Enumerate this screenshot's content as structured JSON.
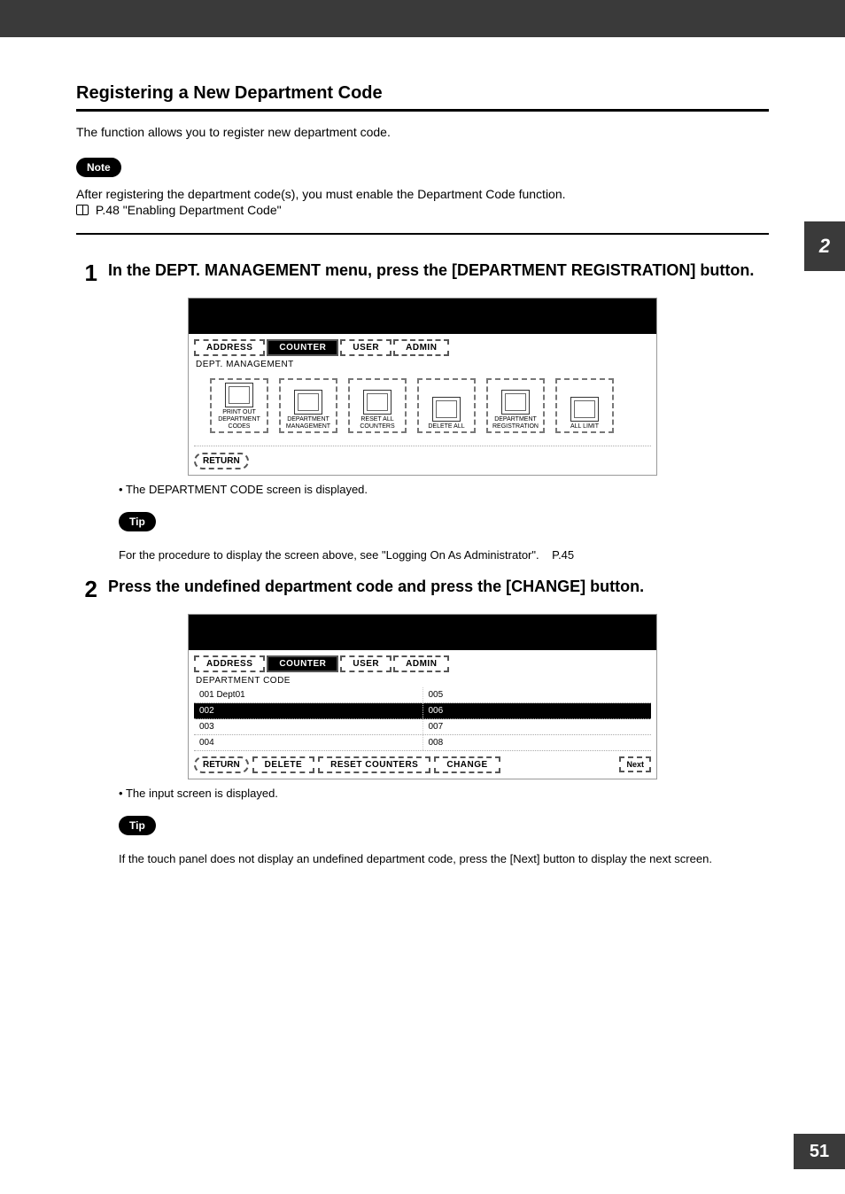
{
  "chapter_number": "2",
  "page_number": "51",
  "header": {
    "title": "Registering a New Department Code",
    "intro": "The function allows you to register new department code."
  },
  "note": {
    "badge": "Note",
    "text": "After registering the department code(s), you must enable the Department Code function.",
    "ref": "P.48 \"Enabling Department Code\""
  },
  "steps": [
    {
      "num": "1",
      "text": "In the DEPT. MANAGEMENT menu, press the [DEPARTMENT REGISTRATION] button.",
      "bullet": "The DEPARTMENT CODE screen is displayed.",
      "tip_badge": "Tip",
      "tip_text": "For the procedure to display the screen above, see \"Logging On As Administrator\".",
      "tip_ref": "P.45",
      "screenshot": {
        "tabs": [
          "ADDRESS",
          "COUNTER",
          "USER",
          "ADMIN"
        ],
        "active_tab": 1,
        "header": "DEPT. MANAGEMENT",
        "icons": [
          "PRINT OUT DEPARTMENT CODES",
          "DEPARTMENT MANAGEMENT",
          "RESET ALL COUNTERS",
          "DELETE ALL",
          "DEPARTMENT REGISTRATION",
          "ALL LIMIT"
        ],
        "return": "RETURN"
      }
    },
    {
      "num": "2",
      "text": "Press the undefined department code and press the [CHANGE] button.",
      "bullet": "The input screen is displayed.",
      "tip_badge": "Tip",
      "tip_text": "If the touch panel does not display an undefined department code, press the [Next] button to display the next screen.",
      "screenshot": {
        "tabs": [
          "ADDRESS",
          "COUNTER",
          "USER",
          "ADMIN"
        ],
        "active_tab": 1,
        "header": "DEPARTMENT CODE",
        "rows": [
          {
            "left": "001 Dept01",
            "right": "005"
          },
          {
            "left": "002",
            "right": "006",
            "highlight": true
          },
          {
            "left": "003",
            "right": "007"
          },
          {
            "left": "004",
            "right": "008"
          }
        ],
        "footer": [
          "RETURN",
          "DELETE",
          "RESET COUNTERS",
          "CHANGE"
        ],
        "next": "Next"
      }
    }
  ]
}
